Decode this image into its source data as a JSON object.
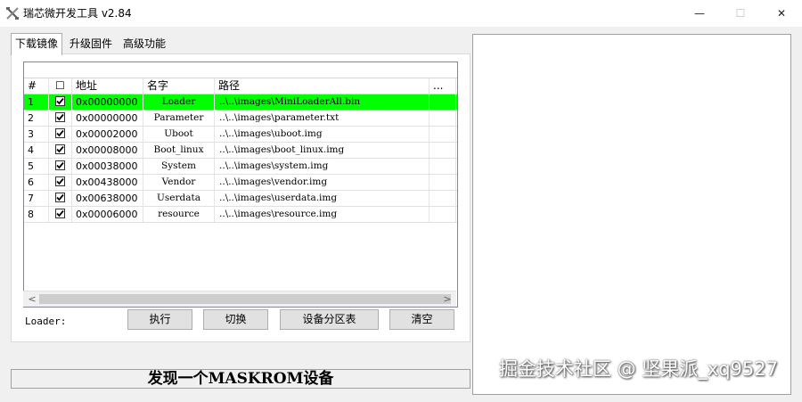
{
  "window": {
    "title": "瑞芯微开发工具 v2.84",
    "controls": {
      "minimize": "—",
      "maximize": "☐",
      "close": "✕"
    }
  },
  "tabs": [
    {
      "label": "下载镜像",
      "active": true
    },
    {
      "label": "升级固件",
      "active": false
    },
    {
      "label": "高级功能",
      "active": false
    }
  ],
  "table": {
    "headers": [
      "#",
      "☐",
      "地址",
      "名字",
      "路径",
      "..."
    ],
    "rows": [
      {
        "num": "1",
        "checked": true,
        "address": "0x00000000",
        "name": "Loader",
        "path": "..\\..\\images\\MiniLoaderAll.bin",
        "selected": true
      },
      {
        "num": "2",
        "checked": true,
        "address": "0x00000000",
        "name": "Parameter",
        "path": "..\\..\\images\\parameter.txt",
        "selected": false
      },
      {
        "num": "3",
        "checked": true,
        "address": "0x00002000",
        "name": "Uboot",
        "path": "..\\..\\images\\uboot.img",
        "selected": false
      },
      {
        "num": "4",
        "checked": true,
        "address": "0x00008000",
        "name": "Boot_linux",
        "path": "..\\..\\images\\boot_linux.img",
        "selected": false
      },
      {
        "num": "5",
        "checked": true,
        "address": "0x00038000",
        "name": "System",
        "path": "..\\..\\images\\system.img",
        "selected": false
      },
      {
        "num": "6",
        "checked": true,
        "address": "0x00438000",
        "name": "Vendor",
        "path": "..\\..\\images\\vendor.img",
        "selected": false
      },
      {
        "num": "7",
        "checked": true,
        "address": "0x00638000",
        "name": "Userdata",
        "path": "..\\..\\images\\userdata.img",
        "selected": false
      },
      {
        "num": "8",
        "checked": true,
        "address": "0x00006000",
        "name": "resource",
        "path": "..\\..\\images\\resource.img",
        "selected": false
      }
    ],
    "selected_color": "#00ff00"
  },
  "scroll": {
    "left": "<",
    "right": ">"
  },
  "loader_label": "Loader:",
  "buttons": {
    "execute": "执行",
    "switch": "切换",
    "partition_table": "设备分区表",
    "clear": "清空"
  },
  "status": "发现一个MASKROM设备",
  "watermark": "掘金技术社区 @ 坚果派_xq9527"
}
